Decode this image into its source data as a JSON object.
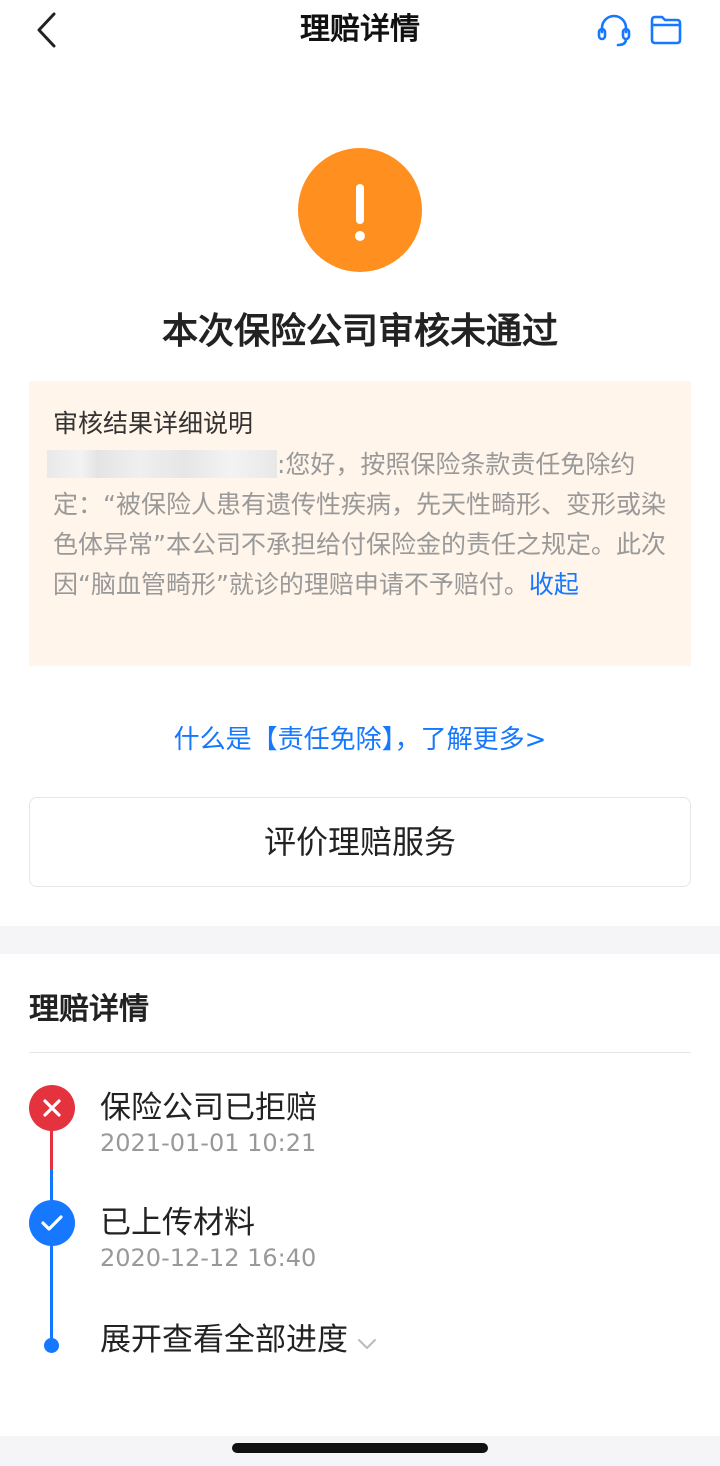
{
  "nav": {
    "title": "理赔详情",
    "back_icon": "chevron-left-icon",
    "service_icon": "headset-icon",
    "folder_icon": "folder-icon"
  },
  "status": {
    "icon": "exclamation-icon",
    "title": "本次保险公司审核未通过",
    "color": "#FF8F1F"
  },
  "detail": {
    "title": "审核结果详细说明",
    "body": ":您好，按照保险条款责任免除约定：“被保险人患有遗传性疾病，先天性畸形、变形或染色体异常”本公司不承担给付保险金的责任之规定。此次因“脑血管畸形”就诊的理赔申请不予赔付。",
    "collapse_label": "收起",
    "background": "#FFF5EA"
  },
  "learn_more": "什么是【责任免除】，了解更多>",
  "evaluate_button": "评价理赔服务",
  "section": {
    "title": "理赔详情"
  },
  "timeline": [
    {
      "title": "保险公司已拒赔",
      "time": "2021-01-01 10:21",
      "status": "rejected",
      "color": "#E5323F"
    },
    {
      "title": "已上传材料",
      "time": "2020-12-12 16:40",
      "status": "done",
      "color": "#1677FF"
    }
  ],
  "expand_label": "展开查看全部进度",
  "accent_color": "#1677FF"
}
